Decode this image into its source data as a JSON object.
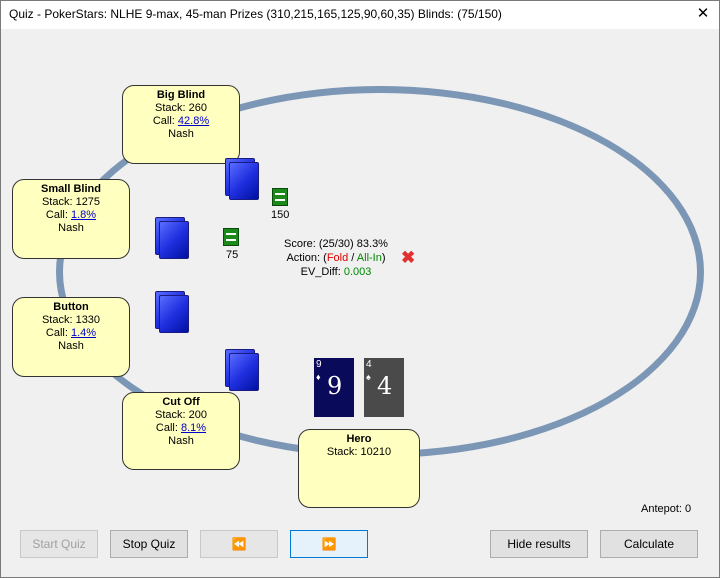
{
  "window": {
    "title": "Quiz - PokerStars: NLHE 9-max, 45-man Prizes (310,215,165,125,90,60,35) Blinds: (75/150)",
    "close_glyph": "✕"
  },
  "seats": {
    "big_blind": {
      "name": "Big Blind",
      "stack": "Stack: 260",
      "call_prefix": "Call: ",
      "call_pct": "42.8%",
      "strategy": "Nash"
    },
    "small_blind": {
      "name": "Small Blind",
      "stack": "Stack: 1275",
      "call_prefix": "Call: ",
      "call_pct": "1.8%",
      "strategy": "Nash"
    },
    "button": {
      "name": "Button",
      "stack": "Stack: 1330",
      "call_prefix": "Call: ",
      "call_pct": "1.4%",
      "strategy": "Nash"
    },
    "cut_off": {
      "name": "Cut Off",
      "stack": "Stack: 200",
      "call_prefix": "Call: ",
      "call_pct": "8.1%",
      "strategy": "Nash"
    },
    "hero": {
      "name": "Hero",
      "stack": "Stack: 10210"
    }
  },
  "bets": {
    "big_blind": "150",
    "small_blind": "75"
  },
  "result": {
    "score": "Score: (25/30) 83.3%",
    "action_label": "Action: (",
    "fold": "Fold",
    "sep": " / ",
    "allin": "All-In",
    "close_paren": ")",
    "ev_label": "EV_Diff: ",
    "ev_value": "0.003",
    "wrong_glyph": "✖"
  },
  "hero_cards": [
    {
      "rank": "9",
      "suit": "♦",
      "color": "#0a0a5a"
    },
    {
      "rank": "4",
      "suit": "♠",
      "color": "#4a4a4a"
    }
  ],
  "antepot": "Antepot: 0",
  "buttons": {
    "start_quiz": "Start Quiz",
    "stop_quiz": "Stop Quiz",
    "prev": "⏪",
    "next": "⏩",
    "hide_results": "Hide results",
    "calculate": "Calculate"
  }
}
